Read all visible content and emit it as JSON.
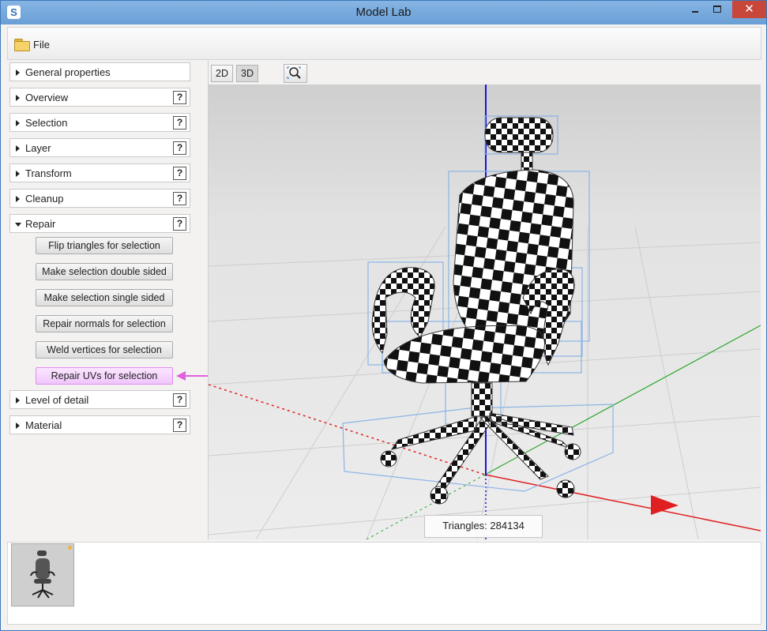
{
  "window": {
    "title": "Model Lab",
    "app_icon": "app-logo-icon",
    "close_glyph": "✕"
  },
  "menu": {
    "file_label": "File"
  },
  "sections": [
    {
      "label": "General properties",
      "help": false,
      "expanded": false
    },
    {
      "label": "Overview",
      "help": true,
      "expanded": false
    },
    {
      "label": "Selection",
      "help": true,
      "expanded": false
    },
    {
      "label": "Layer",
      "help": true,
      "expanded": false
    },
    {
      "label": "Transform",
      "help": true,
      "expanded": false
    },
    {
      "label": "Cleanup",
      "help": true,
      "expanded": false
    },
    {
      "label": "Repair",
      "help": true,
      "expanded": true
    },
    {
      "label": "Level of detail",
      "help": true,
      "expanded": false
    },
    {
      "label": "Material",
      "help": true,
      "expanded": false
    }
  ],
  "help_glyph": "?",
  "repair_actions": [
    "Flip triangles for selection",
    "Make selection double sided",
    "Make selection single sided",
    "Repair normals for selection",
    "Weld vertices for selection",
    "Repair UVs for selection"
  ],
  "highlighted_action": "Repair UVs for selection",
  "view_modes": {
    "mode_2d": "2D",
    "mode_3d": "3D",
    "active": "3D"
  },
  "stats": {
    "triangles_label": "Triangles:",
    "triangles": "284134"
  },
  "colors": {
    "x_axis": "#e02020",
    "y_axis": "#2aa52a",
    "z_axis": "#1414e0",
    "annotation": "#e060e0",
    "bounding_box": "#8cb4e6"
  }
}
